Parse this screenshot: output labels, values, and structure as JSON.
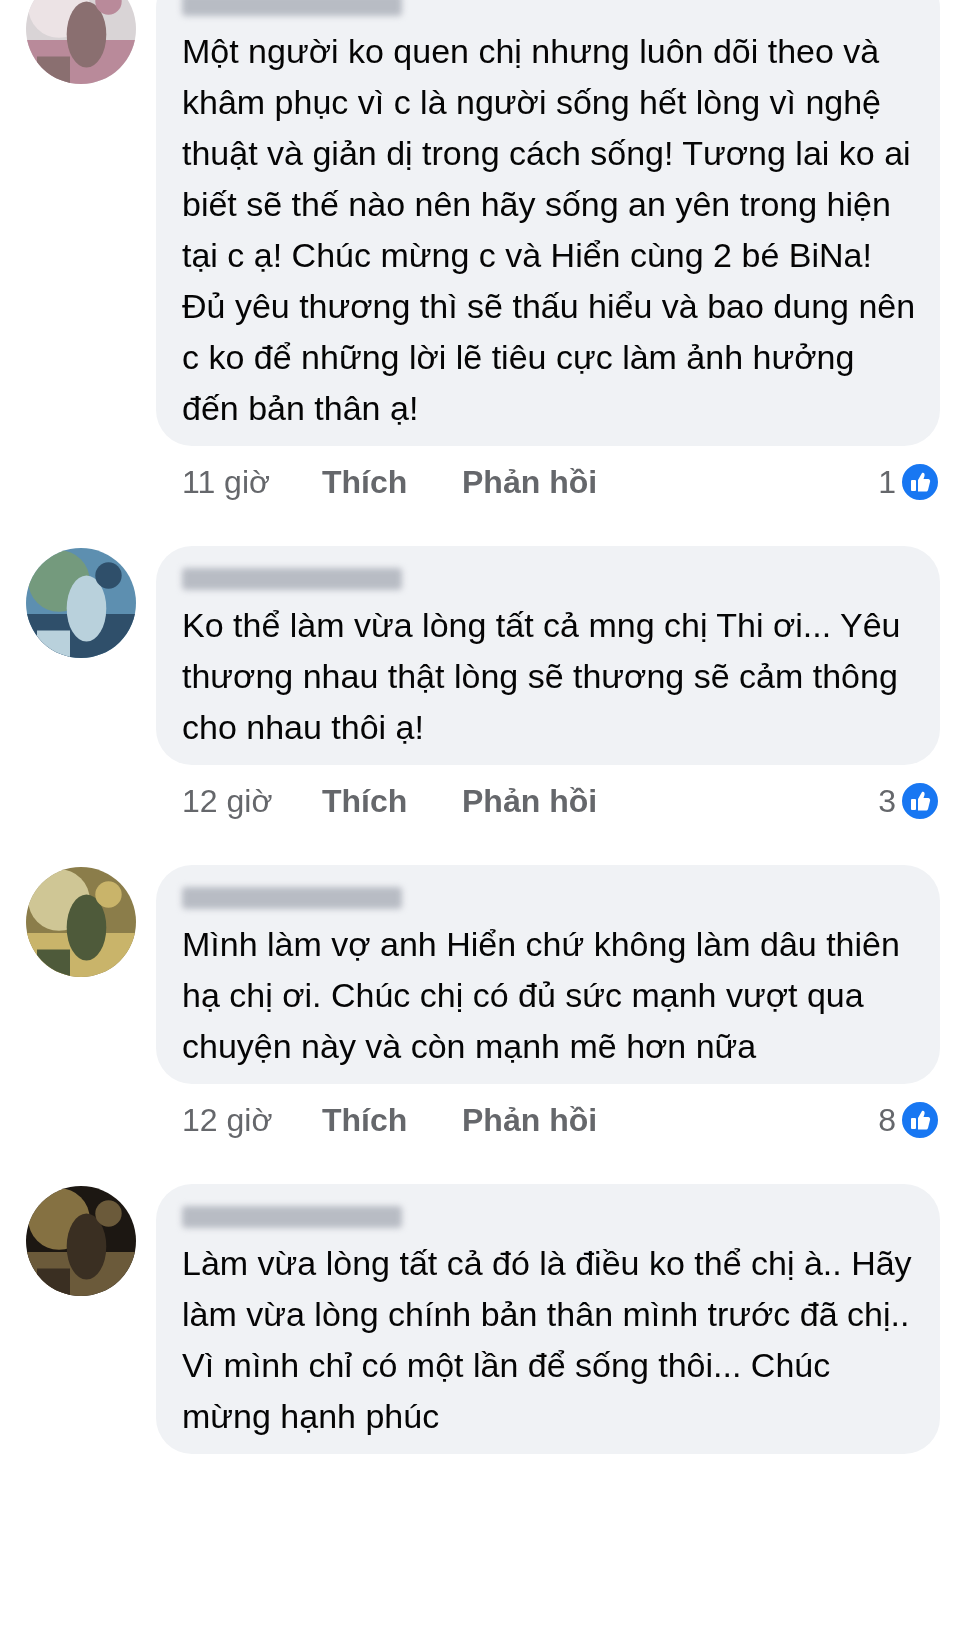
{
  "comments": [
    {
      "text": "Một người ko quen chị nhưng luôn dõi theo và khâm phục vì c là người sống hết lòng vì nghệ thuật và giản dị trong cách sống! Tương lai ko ai biết sẽ thế nào nên hãy sống an yên trong hiện tại c ạ! Chúc mừng c và Hiển cùng 2 bé BiNa! Đủ yêu thương thì sẽ thấu hiểu và bao dung nên c ko để những lời lẽ tiêu cực làm ảnh hưởng đến bản thân ạ!",
      "time": "11 giờ",
      "like": "Thích",
      "reply": "Phản hồi",
      "reactions": "1"
    },
    {
      "text": "Ko thể làm vừa lòng tất cả mng chị Thi ơi... Yêu thương nhau thật lòng sẽ thương sẽ cảm thông cho nhau thôi ạ!",
      "time": "12 giờ",
      "like": "Thích",
      "reply": "Phản hồi",
      "reactions": "3"
    },
    {
      "text": "Mình làm vợ anh Hiển chứ không làm dâu thiên hạ chị ơi. Chúc chị có đủ sức mạnh vượt qua chuyện này và còn mạnh mẽ hơn nữa",
      "time": "12 giờ",
      "like": "Thích",
      "reply": "Phản hồi",
      "reactions": "8"
    },
    {
      "text": "Làm vừa lòng tất cả đó là điều ko thể chị à.. Hãy làm vừa lòng chính bản thân mình trước đã chị.. Vì mình chỉ có một lần để sống thôi... Chúc mừng hạnh phúc"
    }
  ]
}
